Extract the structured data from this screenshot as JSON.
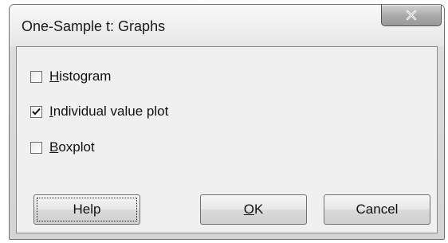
{
  "window": {
    "title": "One-Sample t: Graphs",
    "close_icon": "close-icon"
  },
  "options": [
    {
      "mnemonic": "H",
      "rest": "istogram",
      "checked": false
    },
    {
      "mnemonic": "I",
      "rest": "ndividual value plot",
      "checked": true
    },
    {
      "mnemonic": "B",
      "rest": "oxplot",
      "checked": false
    }
  ],
  "buttons": {
    "help": {
      "label": "Help"
    },
    "ok": {
      "mnemonic": "O",
      "rest": "K"
    },
    "cancel": {
      "label": "Cancel"
    }
  }
}
